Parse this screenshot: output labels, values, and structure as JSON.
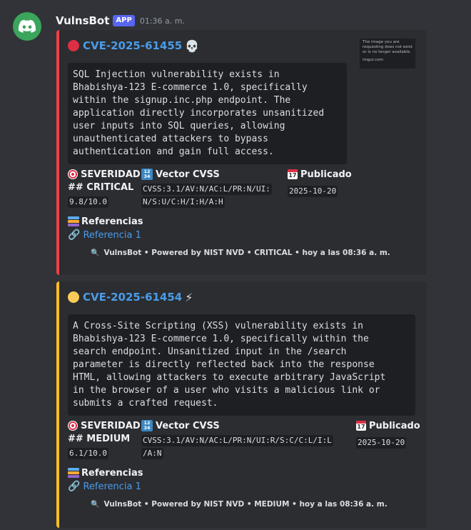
{
  "message": {
    "username": "VulnsBot",
    "badge": "APP",
    "time": "01:36 a. m."
  },
  "embeds": [
    {
      "title": "CVE-2025-61455",
      "title_emoji": "💀",
      "color": "#ed4245",
      "thumbnail_text": "The image you are requesting does not exist or is no longer available.",
      "thumbnail_site": "imgur.com",
      "description": "SQL Injection vulnerability exists in\nBhabishya-123 E-commerce 1.0, specifically\nwithin the signup.inc.php endpoint. The\napplication directly incorporates unsanitized\nuser inputs into SQL queries, allowing\nunauthenticated attackers to bypass\nauthentication and gain full access.",
      "severity_label": "SEVERIDAD",
      "severity_value": "## CRITICAL",
      "score": "9.8/10.0",
      "cvss_label": "Vector CVSS",
      "cvss_line1": "CVSS:3.1/AV:N/AC:L/PR:N/UI:",
      "cvss_line2": "N/S:U/C:H/I:H/A:H",
      "published_label": "Publicado",
      "published_date": "2025-10-20",
      "refs_label": "Referencias",
      "ref1": "Referencia 1",
      "footer": "VulnsBot • Powered by NIST NVD • CRITICAL • hoy a las 08:36 a. m."
    },
    {
      "title": "CVE-2025-61454",
      "title_emoji": "⚡",
      "color": "#fbbd23",
      "description": "A Cross-Site Scripting (XSS) vulnerability exists in\nBhabishya-123 E-commerce 1.0, specifically within the\nsearch endpoint. Unsanitized input in the /search\nparameter is directly reflected back into the response\nHTML, allowing attackers to execute arbitrary JavaScript\nin the browser of a user who visits a malicious link or\nsubmits a crafted request.",
      "severity_label": "SEVERIDAD",
      "severity_value": "## MEDIUM",
      "score": "6.1/10.0",
      "cvss_label": "Vector CVSS",
      "cvss_line1": "CVSS:3.1/AV:N/AC:L/PR:N/UI:R/S:C/C:L/I:L",
      "cvss_line2": "/A:N",
      "published_label": "Publicado",
      "published_date": "2025-10-20",
      "refs_label": "Referencias",
      "ref1": "Referencia 1",
      "footer": "VulnsBot • Powered by NIST NVD • MEDIUM • hoy a las 08:36 a. m."
    }
  ],
  "icons": {
    "avatar": "discord-logo-icon",
    "target": "target-icon",
    "numbers": "numbers-1234-icon",
    "calendar": "calendar-icon",
    "books": "books-icon",
    "link": "link-icon",
    "search": "magnifier-icon"
  }
}
